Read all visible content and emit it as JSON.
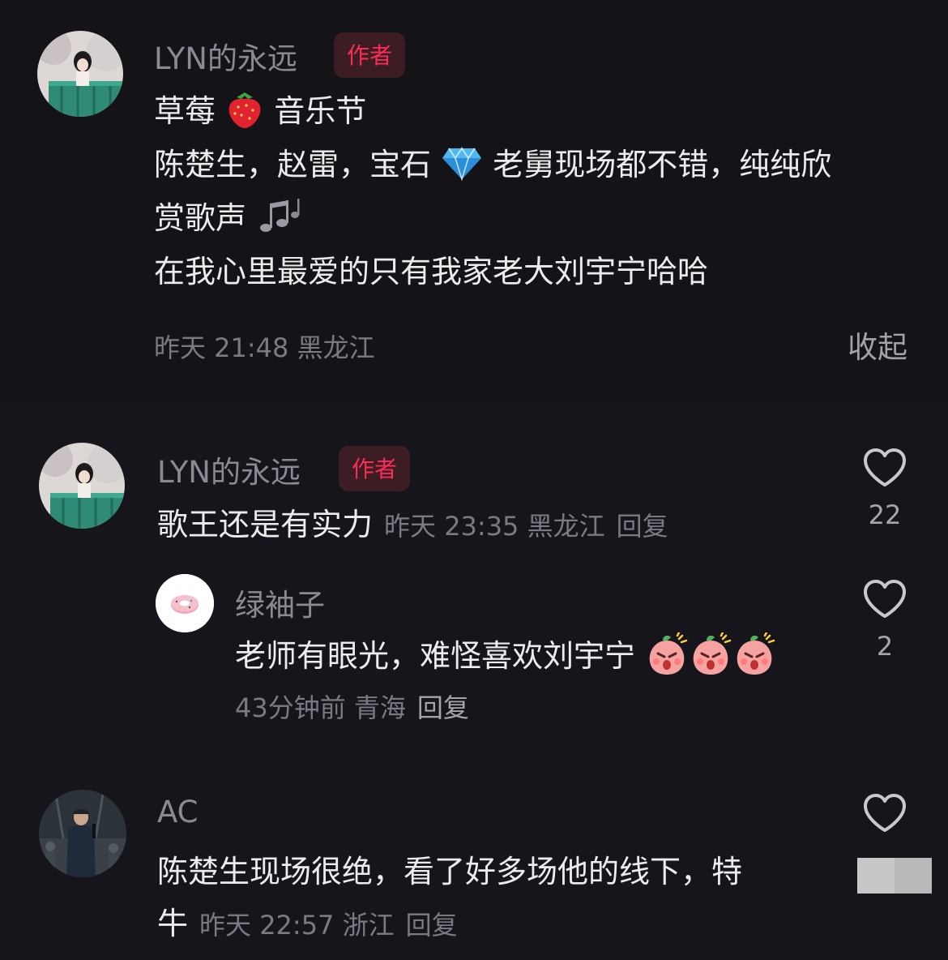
{
  "post": {
    "author": "LYN的永远",
    "badge": "作者",
    "line1a": "草莓",
    "line1b": "音乐节",
    "line2a": "陈楚生，赵雷，宝石",
    "line2b": "老舅现场都不错，纯纯欣",
    "line3": "赏歌声",
    "line4": "在我心里最爱的只有我家老大刘宇宁哈哈",
    "meta": "昨天 21:48 黑龙江",
    "collapse_label": "收起"
  },
  "comments": [
    {
      "author": "LYN的永远",
      "badge": "作者",
      "text": "歌王还是有实力",
      "meta": "昨天 23:35 黑龙江",
      "reply_label": "回复",
      "likes": "22"
    },
    {
      "author": "绿袖子",
      "text": "老师有眼光，难怪喜欢刘宇宁",
      "meta": "43分钟前 青海",
      "reply_label": "回复",
      "likes": "2"
    },
    {
      "author": "AC",
      "text1": "陈楚生现场很绝，看了好多场他的线下，特",
      "text2": "牛",
      "meta": "昨天 22:57 浙江",
      "reply_label": "回复"
    }
  ],
  "icons": {
    "like": "heart-outline-icon",
    "strawberry": "strawberry-emoji",
    "gem": "gem-emoji",
    "notes": "music-notes-emoji",
    "peach": "angry-peach-emoji"
  },
  "colors": {
    "background": "#16151c",
    "author_badge_text": "#fd2c55",
    "author_badge_bg": "#3b1d23"
  }
}
